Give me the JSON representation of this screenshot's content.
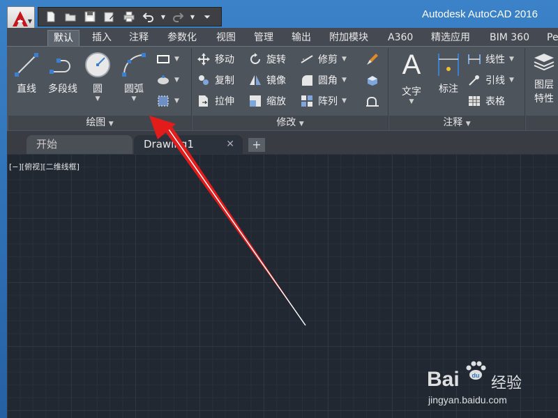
{
  "window": {
    "title": "Autodesk AutoCAD 2016"
  },
  "quick_access": {
    "icons": [
      "new-file-icon",
      "open-folder-icon",
      "save-icon",
      "save-as-icon",
      "print-icon",
      "undo-icon",
      "redo-icon",
      "customize-icon"
    ]
  },
  "ribbon_tabs": [
    {
      "label": "默认",
      "active": true
    },
    {
      "label": "插入"
    },
    {
      "label": "注释"
    },
    {
      "label": "参数化"
    },
    {
      "label": "视图"
    },
    {
      "label": "管理"
    },
    {
      "label": "输出"
    },
    {
      "label": "附加模块"
    },
    {
      "label": "A360"
    },
    {
      "label": "精选应用"
    },
    {
      "label": "BIM 360"
    },
    {
      "label": "Pe"
    }
  ],
  "draw_panel": {
    "title": "绘图",
    "line": "直线",
    "polyline": "多段线",
    "circle": "圆",
    "arc": "圆弧"
  },
  "modify_panel": {
    "title": "修改",
    "move": "移动",
    "rotate": "旋转",
    "trim": "修剪",
    "copy": "复制",
    "mirror": "镜像",
    "fillet": "圆角",
    "stretch": "拉伸",
    "scale": "缩放",
    "array": "阵列"
  },
  "annotation_panel": {
    "title": "注释",
    "text": "文字",
    "dimension": "标注",
    "linear": "线性",
    "leader": "引线",
    "table": "表格"
  },
  "layers_panel": {
    "layer_props_line1": "图层",
    "layer_props_line2": "特性"
  },
  "file_tabs": [
    {
      "label": "开始"
    },
    {
      "label": "Drawing1",
      "active": true
    }
  ],
  "viewport_label": "[−][俯视][二维线框]",
  "watermark": {
    "main": "Bai",
    "cn": "经验",
    "url": "jingyan.baidu.com"
  },
  "colors": {
    "accent_red": "#e21b1b",
    "ribbon_bg": "#4e545c",
    "canvas_bg": "#212832",
    "window_frame": "#2a6bb0"
  }
}
